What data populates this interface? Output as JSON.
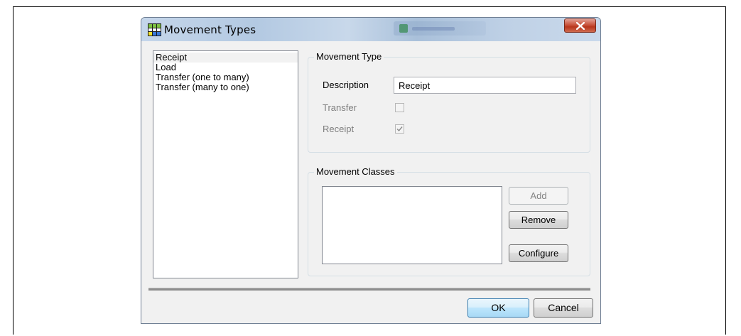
{
  "window": {
    "title": "Movement Types",
    "icon": "grid-app-icon",
    "close_icon": "close-x-icon"
  },
  "movement_list": {
    "items": [
      {
        "label": "Receipt",
        "selected": true
      },
      {
        "label": "Load",
        "selected": false
      },
      {
        "label": "Transfer (one to many)",
        "selected": false
      },
      {
        "label": "Transfer (many to one)",
        "selected": false
      }
    ]
  },
  "movement_type": {
    "group_title": "Movement Type",
    "description_label": "Description",
    "description_value": "Receipt",
    "transfer_label": "Transfer",
    "transfer_checked": false,
    "receipt_label": "Receipt",
    "receipt_checked": true
  },
  "movement_classes": {
    "group_title": "Movement Classes",
    "add_label": "Add",
    "remove_label": "Remove",
    "configure_label": "Configure"
  },
  "footer": {
    "ok_label": "OK",
    "cancel_label": "Cancel"
  },
  "colors": {
    "close_button": "#c8533b",
    "ok_button_border": "#3c7fb1"
  }
}
